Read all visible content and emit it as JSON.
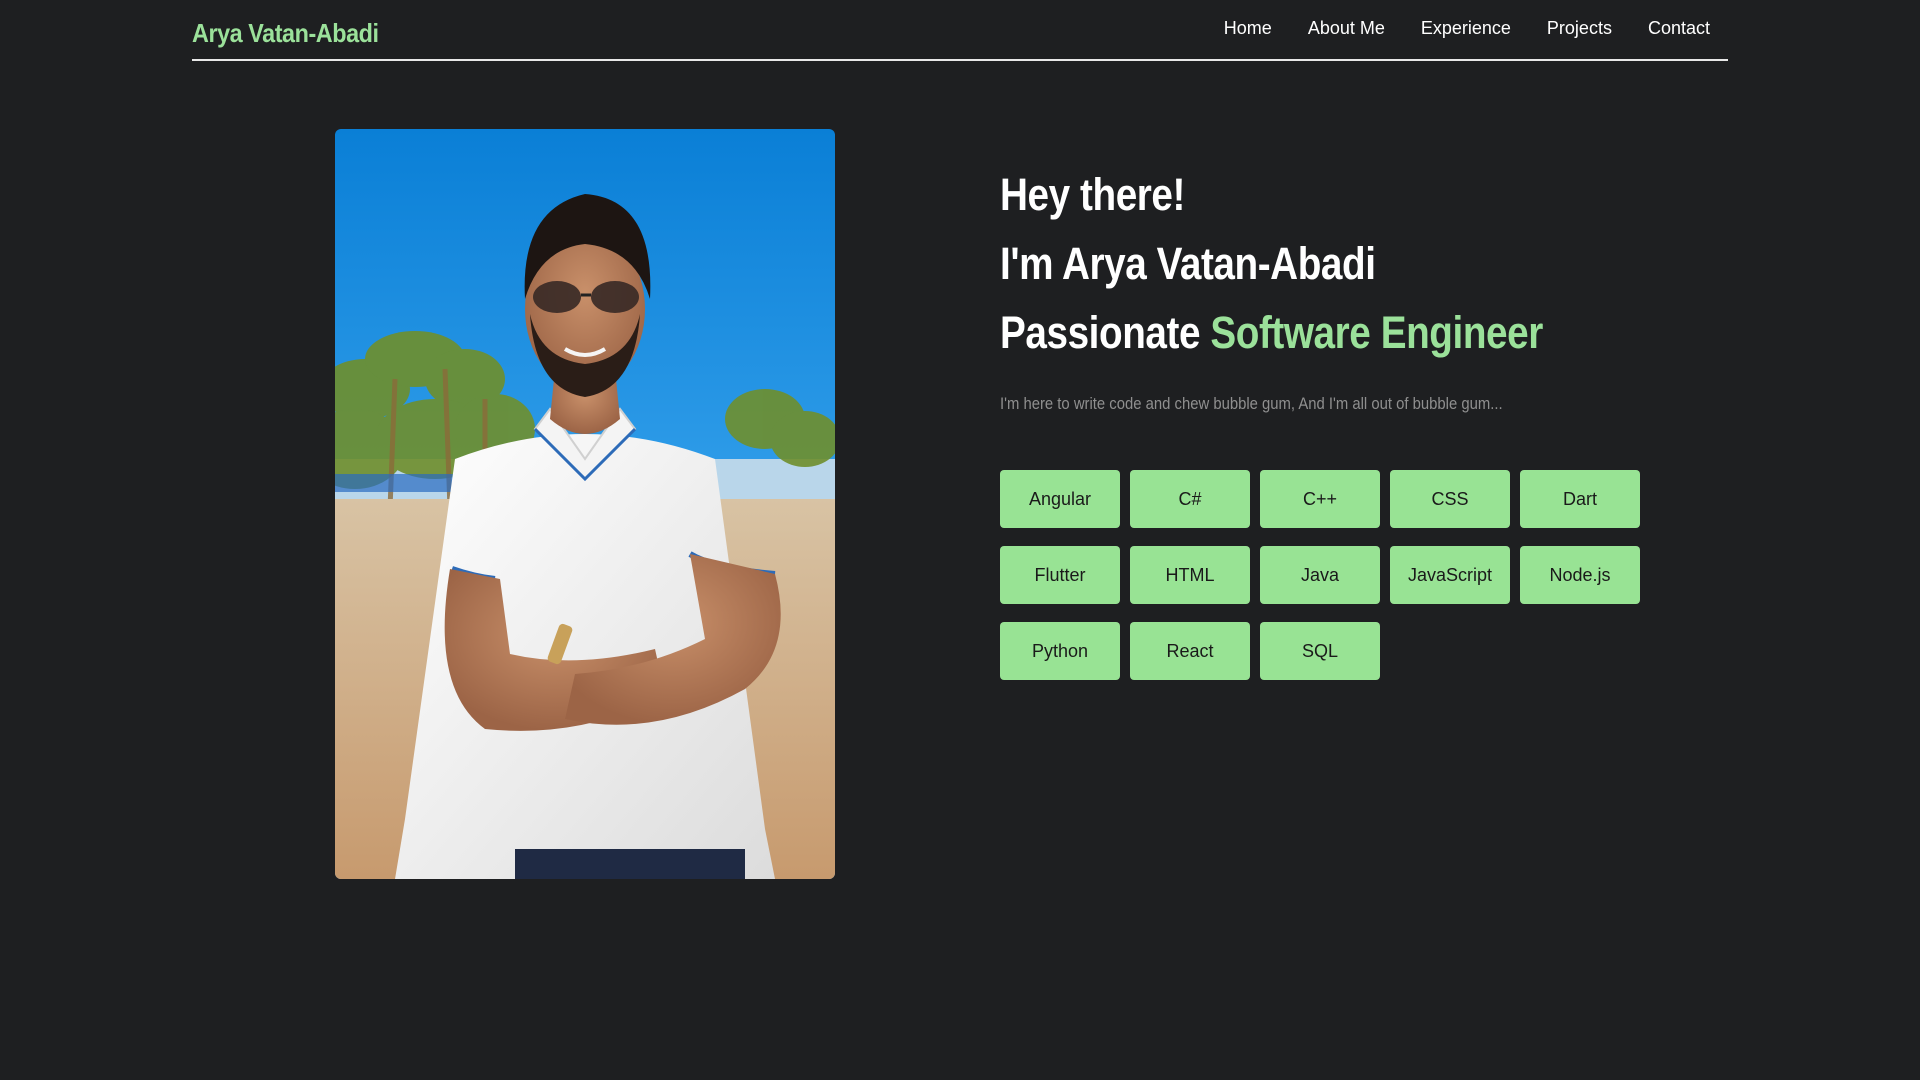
{
  "brand": {
    "name": "Arya Vatan-Abadi"
  },
  "nav": {
    "items": [
      {
        "label": "Home"
      },
      {
        "label": "About Me"
      },
      {
        "label": "Experience"
      },
      {
        "label": "Projects"
      },
      {
        "label": "Contact"
      }
    ]
  },
  "hero": {
    "line1": "Hey there!",
    "line2": "I'm Arya Vatan-Abadi",
    "line3_prefix": "Passionate ",
    "line3_accent": "Software Engineer",
    "tagline": "I'm here to write code and chew bubble gum, And I'm all out of bubble gum..."
  },
  "skills": [
    "Angular",
    "C#",
    "C++",
    "CSS",
    "Dart",
    "Flutter",
    "HTML",
    "Java",
    "JavaScript",
    "Node.js",
    "Python",
    "React",
    "SQL"
  ],
  "colors": {
    "background": "#1e1f21",
    "accent": "#9be19a",
    "skill_bg": "#98e394",
    "tagline": "#8f8f8f"
  }
}
